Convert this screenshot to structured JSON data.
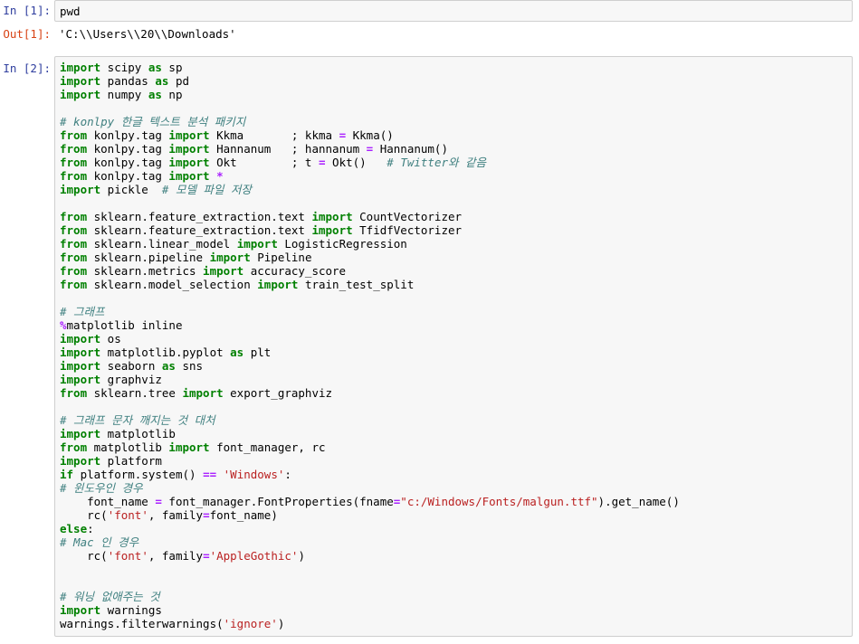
{
  "cells": [
    {
      "prompt": "In [1]:",
      "code": [
        [
          [
            "tx",
            "pwd"
          ]
        ]
      ]
    },
    {
      "output_prompt": "Out[1]:",
      "output": "'C:\\\\Users\\\\20\\\\Downloads'"
    },
    {
      "prompt": "In [2]:",
      "code": [
        [
          [
            "kw",
            "import"
          ],
          [
            "tx",
            " scipy "
          ],
          [
            "kw",
            "as"
          ],
          [
            "tx",
            " sp"
          ]
        ],
        [
          [
            "kw",
            "import"
          ],
          [
            "tx",
            " pandas "
          ],
          [
            "kw",
            "as"
          ],
          [
            "tx",
            " pd"
          ]
        ],
        [
          [
            "kw",
            "import"
          ],
          [
            "tx",
            " numpy "
          ],
          [
            "kw",
            "as"
          ],
          [
            "tx",
            " np"
          ]
        ],
        [],
        [
          [
            "cm",
            "# konlpy 한글 텍스트 분석 패키지"
          ]
        ],
        [
          [
            "kw",
            "from"
          ],
          [
            "tx",
            " konlpy.tag "
          ],
          [
            "kw",
            "import"
          ],
          [
            "tx",
            " Kkma       ; kkma "
          ],
          [
            "op",
            "="
          ],
          [
            "tx",
            " Kkma()"
          ]
        ],
        [
          [
            "kw",
            "from"
          ],
          [
            "tx",
            " konlpy.tag "
          ],
          [
            "kw",
            "import"
          ],
          [
            "tx",
            " Hannanum   ; hannanum "
          ],
          [
            "op",
            "="
          ],
          [
            "tx",
            " Hannanum()"
          ]
        ],
        [
          [
            "kw",
            "from"
          ],
          [
            "tx",
            " konlpy.tag "
          ],
          [
            "kw",
            "import"
          ],
          [
            "tx",
            " Okt        ; t "
          ],
          [
            "op",
            "="
          ],
          [
            "tx",
            " Okt()   "
          ],
          [
            "cm",
            "# Twitter와 같음"
          ]
        ],
        [
          [
            "kw",
            "from"
          ],
          [
            "tx",
            " konlpy.tag "
          ],
          [
            "kw",
            "import"
          ],
          [
            "tx",
            " "
          ],
          [
            "op",
            "*"
          ]
        ],
        [
          [
            "kw",
            "import"
          ],
          [
            "tx",
            " pickle  "
          ],
          [
            "cm",
            "# 모델 파일 저장"
          ]
        ],
        [],
        [
          [
            "kw",
            "from"
          ],
          [
            "tx",
            " sklearn.feature_extraction.text "
          ],
          [
            "kw",
            "import"
          ],
          [
            "tx",
            " CountVectorizer"
          ]
        ],
        [
          [
            "kw",
            "from"
          ],
          [
            "tx",
            " sklearn.feature_extraction.text "
          ],
          [
            "kw",
            "import"
          ],
          [
            "tx",
            " TfidfVectorizer"
          ]
        ],
        [
          [
            "kw",
            "from"
          ],
          [
            "tx",
            " sklearn.linear_model "
          ],
          [
            "kw",
            "import"
          ],
          [
            "tx",
            " LogisticRegression"
          ]
        ],
        [
          [
            "kw",
            "from"
          ],
          [
            "tx",
            " sklearn.pipeline "
          ],
          [
            "kw",
            "import"
          ],
          [
            "tx",
            " Pipeline"
          ]
        ],
        [
          [
            "kw",
            "from"
          ],
          [
            "tx",
            " sklearn.metrics "
          ],
          [
            "kw",
            "import"
          ],
          [
            "tx",
            " accuracy_score"
          ]
        ],
        [
          [
            "kw",
            "from"
          ],
          [
            "tx",
            " sklearn.model_selection "
          ],
          [
            "kw",
            "import"
          ],
          [
            "tx",
            " train_test_split"
          ]
        ],
        [],
        [
          [
            "cm",
            "# 그래프"
          ]
        ],
        [
          [
            "op",
            "%"
          ],
          [
            "tx",
            "matplotlib inline"
          ]
        ],
        [
          [
            "kw",
            "import"
          ],
          [
            "tx",
            " os"
          ]
        ],
        [
          [
            "kw",
            "import"
          ],
          [
            "tx",
            " matplotlib.pyplot "
          ],
          [
            "kw",
            "as"
          ],
          [
            "tx",
            " plt"
          ]
        ],
        [
          [
            "kw",
            "import"
          ],
          [
            "tx",
            " seaborn "
          ],
          [
            "kw",
            "as"
          ],
          [
            "tx",
            " sns"
          ]
        ],
        [
          [
            "kw",
            "import"
          ],
          [
            "tx",
            " graphviz"
          ]
        ],
        [
          [
            "kw",
            "from"
          ],
          [
            "tx",
            " sklearn.tree "
          ],
          [
            "kw",
            "import"
          ],
          [
            "tx",
            " export_graphviz"
          ]
        ],
        [],
        [
          [
            "cm",
            "# 그래프 문자 깨지는 것 대처"
          ]
        ],
        [
          [
            "kw",
            "import"
          ],
          [
            "tx",
            " matplotlib"
          ]
        ],
        [
          [
            "kw",
            "from"
          ],
          [
            "tx",
            " matplotlib "
          ],
          [
            "kw",
            "import"
          ],
          [
            "tx",
            " font_manager, rc"
          ]
        ],
        [
          [
            "kw",
            "import"
          ],
          [
            "tx",
            " platform"
          ]
        ],
        [
          [
            "kw",
            "if"
          ],
          [
            "tx",
            " platform.system() "
          ],
          [
            "op",
            "=="
          ],
          [
            "tx",
            " "
          ],
          [
            "st",
            "'Windows'"
          ],
          [
            "tx",
            ":"
          ]
        ],
        [
          [
            "cm",
            "# 윈도우인 경우"
          ]
        ],
        [
          [
            "tx",
            "    font_name "
          ],
          [
            "op",
            "="
          ],
          [
            "tx",
            " font_manager.FontProperties(fname"
          ],
          [
            "op",
            "="
          ],
          [
            "st",
            "\"c:/Windows/Fonts/malgun.ttf\""
          ],
          [
            "tx",
            ").get_name()"
          ]
        ],
        [
          [
            "tx",
            "    rc("
          ],
          [
            "st",
            "'font'"
          ],
          [
            "tx",
            ", family"
          ],
          [
            "op",
            "="
          ],
          [
            "tx",
            "font_name)"
          ]
        ],
        [
          [
            "kw",
            "else"
          ],
          [
            "tx",
            ":"
          ]
        ],
        [
          [
            "cm",
            "# Mac 인 경우"
          ]
        ],
        [
          [
            "tx",
            "    rc("
          ],
          [
            "st",
            "'font'"
          ],
          [
            "tx",
            ", family"
          ],
          [
            "op",
            "="
          ],
          [
            "st",
            "'AppleGothic'"
          ],
          [
            "tx",
            ")"
          ]
        ],
        [],
        [],
        [
          [
            "cm",
            "# 워닝 없애주는 것"
          ]
        ],
        [
          [
            "kw",
            "import"
          ],
          [
            "tx",
            " warnings"
          ]
        ],
        [
          [
            "tx",
            "warnings.filterwarnings("
          ],
          [
            "st",
            "'ignore'"
          ],
          [
            "tx",
            ")"
          ]
        ]
      ]
    }
  ]
}
